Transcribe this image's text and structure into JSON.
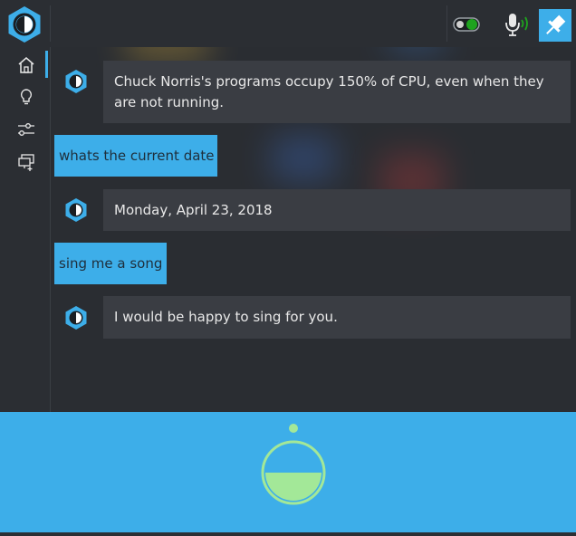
{
  "window": {
    "title": "Mycroft"
  },
  "header": {
    "toggle_state": "on",
    "mic_state": "active",
    "pin_state": "pinned"
  },
  "sidebar": {
    "items": [
      {
        "name": "home",
        "icon": "home-icon",
        "active": true
      },
      {
        "name": "hints",
        "icon": "lightbulb-icon",
        "active": false
      },
      {
        "name": "settings",
        "icon": "sliders-icon",
        "active": false
      },
      {
        "name": "skills",
        "icon": "skills-icon",
        "active": false
      }
    ]
  },
  "conversation": [
    {
      "from": "mycroft",
      "text": "Chuck Norris's programs occupy 150% of CPU, even when they are not running."
    },
    {
      "from": "user",
      "text": "whats the current date"
    },
    {
      "from": "mycroft",
      "text": "Monday, April 23, 2018"
    },
    {
      "from": "user",
      "text": "sing me a song"
    },
    {
      "from": "mycroft",
      "text": "I would be happy to sing for you."
    }
  ],
  "colors": {
    "accent": "#3daee9",
    "background": "#2b2e33",
    "bubble": "#3a3d43",
    "toggle_on": "#1ea31e",
    "listening_fill": "#a3e898"
  }
}
